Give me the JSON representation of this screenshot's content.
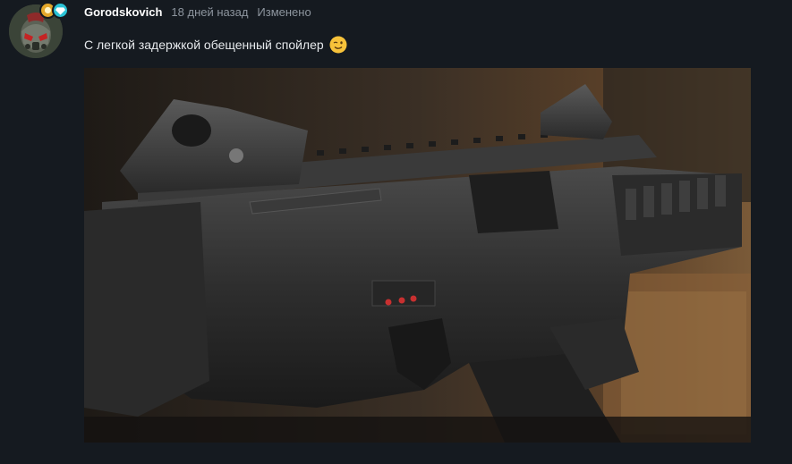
{
  "post": {
    "author": "Gorodskovich",
    "time": "18 дней назад",
    "edited": "Изменено",
    "message": "С легкой задержкой обещенный спойлер",
    "emoji": "wink-emoji",
    "attachment_alt": "image-attachment"
  },
  "badges": [
    {
      "icon": "gold-badge-icon",
      "color": "#e3a72a"
    },
    {
      "icon": "diamond-badge-icon",
      "color": "#2bc3d6"
    }
  ],
  "colors": {
    "background": "#151a20",
    "author": "#ffffff",
    "meta": "#8d959e",
    "text": "#e6e9ec"
  }
}
